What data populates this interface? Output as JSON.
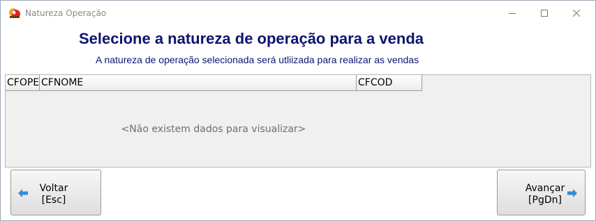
{
  "window": {
    "title": "Natureza Operação"
  },
  "header": {
    "title": "Selecione a natureza de operação para a venda",
    "subtitle": "A natureza de operação selecionada será utliizada para realizar as vendas"
  },
  "grid": {
    "columns": [
      "CFOPE",
      "CFNOME",
      "CFCOD"
    ],
    "empty_message": "<Não existem dados para visualizar>"
  },
  "buttons": {
    "back": {
      "line1": "Voltar",
      "line2": "[Esc]"
    },
    "next": {
      "line1": "Avançar",
      "line2": "[PgDn]"
    }
  },
  "icons": {
    "app": "app-logo-icon",
    "minimize": "minimize-icon",
    "maximize": "maximize-icon",
    "close": "close-icon",
    "back": "arrow-left-icon",
    "next": "arrow-right-icon"
  },
  "colors": {
    "title": "#0d1470",
    "arrow": "#2f8de0"
  }
}
